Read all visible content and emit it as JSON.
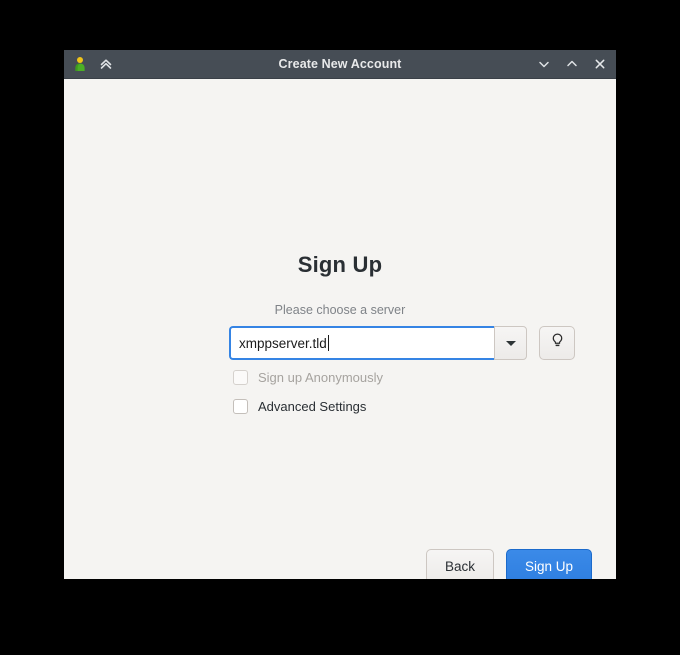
{
  "window": {
    "title": "Create New Account",
    "app_icon": "person-avatar-icon",
    "header_toggle_icon": "double-chevron-up-icon",
    "controls": {
      "minimize": "chevron-down-icon",
      "maximize": "chevron-up-icon",
      "close": "close-x-icon"
    }
  },
  "page": {
    "heading": "Sign Up",
    "subheading": "Please choose a server"
  },
  "server": {
    "value": "xmppserver.tld",
    "placeholder": "",
    "dropdown_icon": "chevron-down-icon",
    "info_button_icon": "lightbulb-icon"
  },
  "options": [
    {
      "id": "sign-up-anonymously",
      "label": "Sign up Anonymously",
      "checked": false,
      "disabled": true
    },
    {
      "id": "advanced-settings",
      "label": "Advanced Settings",
      "checked": false,
      "disabled": false
    }
  ],
  "actions": {
    "back_label": "Back",
    "signup_label": "Sign Up"
  },
  "colors": {
    "titlebar": "#464d55",
    "content_bg": "#f5f4f2",
    "accent_blue": "#3584e4",
    "suggested_button": "#3584e4",
    "desktop_bg": "#000000",
    "heading_text": "#2a2f34",
    "subheading_text": "#7f8388",
    "disabled_text": "#a6a39f"
  }
}
